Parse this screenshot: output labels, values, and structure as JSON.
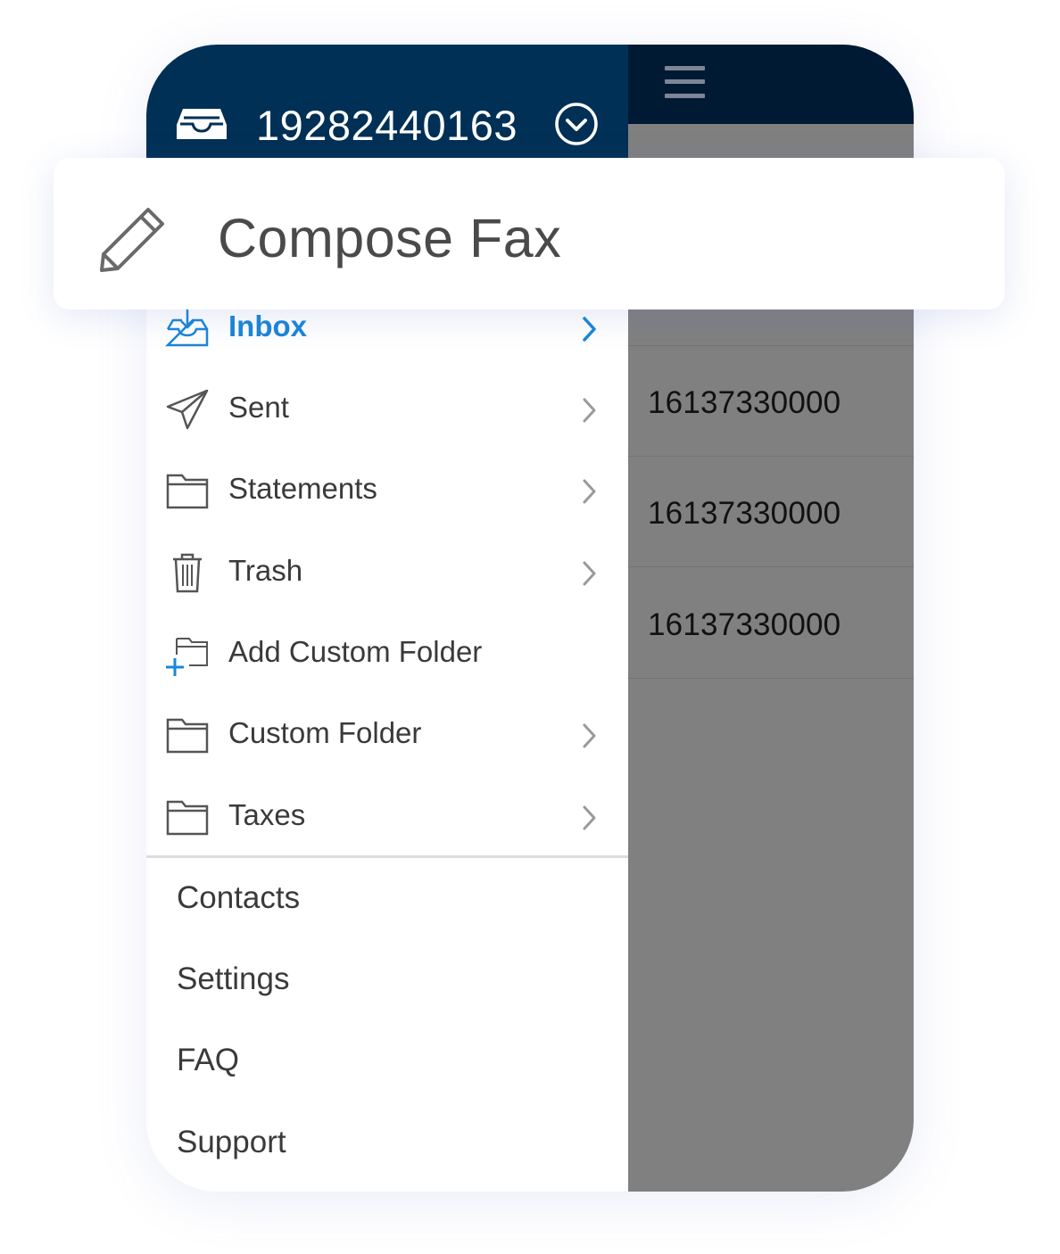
{
  "header": {
    "fax_number": "19282440163",
    "inbox_icon": "inbox-tray-icon",
    "account_switch_icon": "chevron-circle-down-icon",
    "menu_icon": "hamburger-icon"
  },
  "compose": {
    "label": "Compose Fax",
    "icon": "pencil-icon"
  },
  "folders": [
    {
      "label": "Inbox",
      "icon": "inbox-download-icon",
      "active": true
    },
    {
      "label": "Sent",
      "icon": "paper-plane-icon",
      "active": false
    },
    {
      "label": "Statements",
      "icon": "folder-icon",
      "active": false
    },
    {
      "label": "Trash",
      "icon": "trash-icon",
      "active": false
    },
    {
      "label": "Add Custom Folder",
      "icon": "add-folder-icon",
      "active": false
    },
    {
      "label": "Custom Folder",
      "icon": "folder-icon",
      "active": false
    },
    {
      "label": "Taxes",
      "icon": "folder-icon",
      "active": false
    }
  ],
  "links": [
    {
      "label": "Contacts"
    },
    {
      "label": "Settings"
    },
    {
      "label": "FAQ"
    },
    {
      "label": "Support"
    }
  ],
  "fax_list": [
    {
      "number": "16137330000"
    },
    {
      "number": "16137330000"
    },
    {
      "number": "16137330000"
    }
  ],
  "colors": {
    "header_bg": "#003055",
    "accent": "#1a86d8",
    "overlay_gray": "#808080",
    "topbar_dark": "#011a33"
  }
}
